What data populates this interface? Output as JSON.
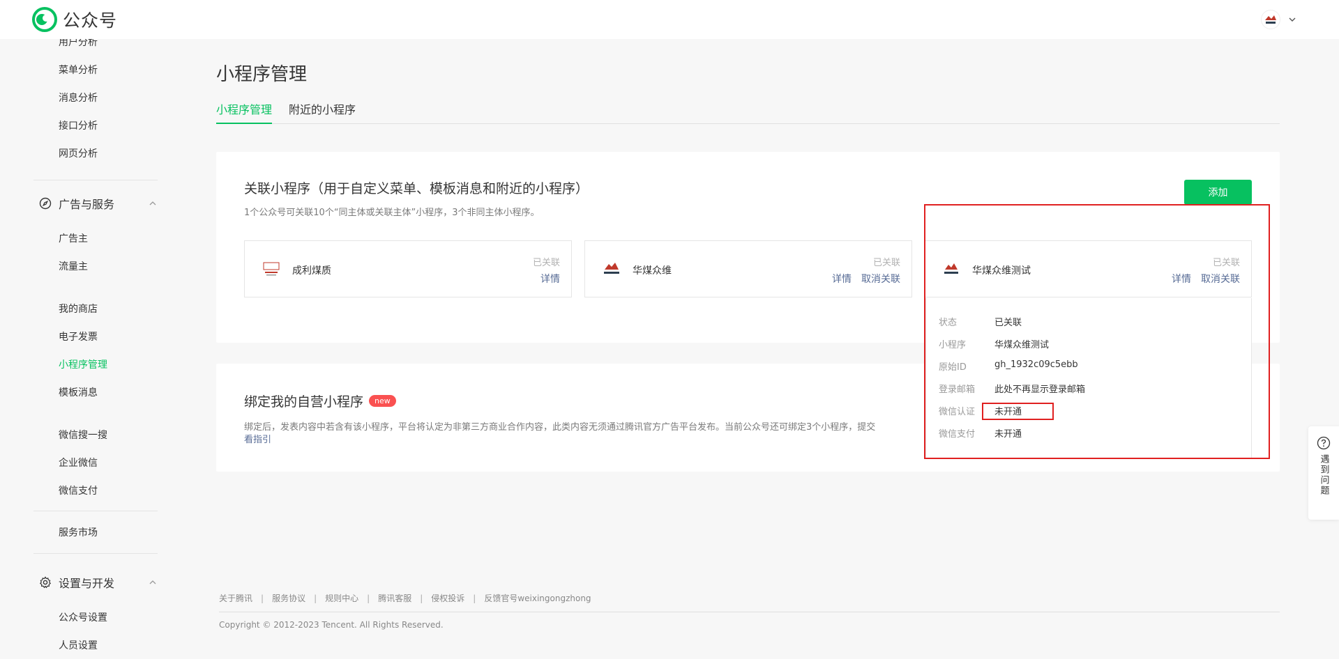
{
  "brand": {
    "name": "公众号",
    "accent": "#07c160"
  },
  "sidebar": {
    "top_items": [
      "用户分析",
      "菜单分析",
      "消息分析",
      "接口分析",
      "网页分析"
    ],
    "group_ads": {
      "label": "广告与服务",
      "icon": "compass-icon"
    },
    "ads_items": [
      "广告主",
      "流量主"
    ],
    "service_items": [
      "我的商店",
      "电子发票",
      "小程序管理",
      "模板消息"
    ],
    "other_items": [
      "微信搜一搜",
      "企业微信",
      "微信支付"
    ],
    "market_items": [
      "服务市场"
    ],
    "group_settings": {
      "label": "设置与开发",
      "icon": "gear-icon"
    },
    "settings_items": [
      "公众号设置",
      "人员设置"
    ]
  },
  "main": {
    "title": "小程序管理",
    "tabs": [
      "小程序管理",
      "附近的小程序"
    ],
    "linked": {
      "title": "关联小程序（用于自定义菜单、模板消息和附近的小程序）",
      "subtitle": "1个公众号可关联10个“同主体或关联主体”小程序，3个非同主体小程序。",
      "add_label": "添加",
      "items": [
        {
          "name": "成利煤质",
          "status": "已关联",
          "detail": "详情",
          "unlink": ""
        },
        {
          "name": "华煤众维",
          "status": "已关联",
          "detail": "详情",
          "unlink": "取消关联"
        },
        {
          "name": "华煤众维测试",
          "status": "已关联",
          "detail": "详情",
          "unlink": "取消关联"
        }
      ]
    },
    "bind": {
      "title": "绑定我的自营小程序",
      "badge": "new",
      "desc": "绑定后，发表内容中若含有该小程序，平台将认定为非第三方商业合作内容，此类内容无须通过腾讯官方广告平台发布。当前公众号还可绑定3个小程序，提交",
      "link": "看指引"
    },
    "detail": {
      "rows": [
        {
          "label": "状态",
          "value": "已关联"
        },
        {
          "label": "小程序",
          "value": "华煤众维测试"
        },
        {
          "label": "原始ID",
          "value": "gh_1932c09c5ebb"
        },
        {
          "label": "登录邮箱",
          "value": "此处不再显示登录邮箱"
        },
        {
          "label": "微信认证",
          "value": "未开通"
        },
        {
          "label": "微信支付",
          "value": "未开通"
        }
      ]
    }
  },
  "footer": {
    "links": [
      "关于腾讯",
      "服务协议",
      "规则中心",
      "腾讯客服",
      "侵权投诉",
      "反馈官号weixingongzhong"
    ],
    "copyright": "Copyright © 2012-2023 Tencent. All Rights Reserved."
  },
  "help": {
    "label": "遇到问题"
  }
}
